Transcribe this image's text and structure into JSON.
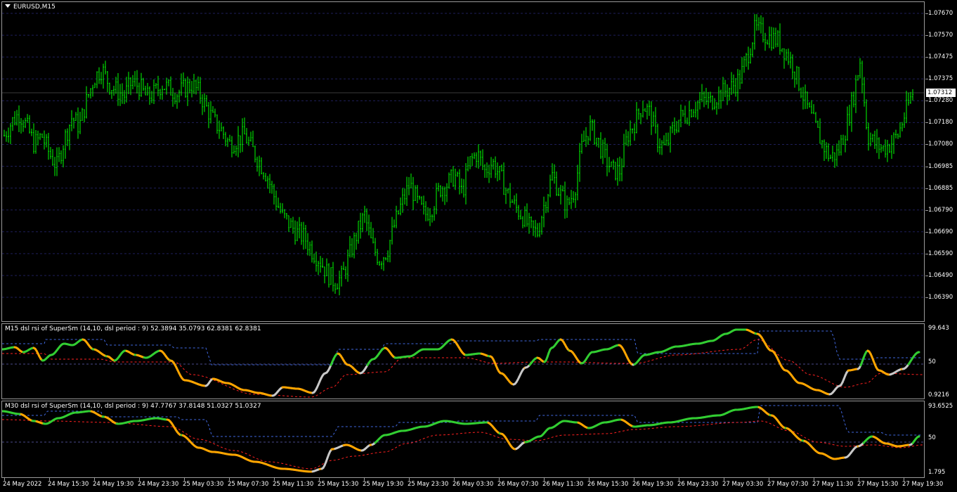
{
  "main": {
    "title": "EURUSD,M15",
    "price_labels": [
      "1.07670",
      "1.07570",
      "1.07475",
      "1.07375",
      "1.07280",
      "1.07180",
      "1.07080",
      "1.06985",
      "1.06885",
      "1.06790",
      "1.06690",
      "1.06590",
      "1.06490",
      "1.06390"
    ],
    "current_price": "1.07312",
    "colors": {
      "candles": "#00ff00",
      "grid": "#1e1e5a",
      "background": "#000000"
    },
    "price_path": [
      1.0712,
      1.0718,
      1.0722,
      1.0716,
      1.0708,
      1.0712,
      1.0704,
      1.0698,
      1.071,
      1.072,
      1.0716,
      1.0728,
      1.0738,
      1.0742,
      1.0735,
      1.0732,
      1.073,
      1.0736,
      1.0734,
      1.0729,
      1.0731,
      1.0735,
      1.0733,
      1.0731,
      1.0733,
      1.0735,
      1.0731,
      1.0724,
      1.0718,
      1.0714,
      1.0708,
      1.071,
      1.0712,
      1.0706,
      1.07,
      1.0694,
      1.0684,
      1.0676,
      1.0672,
      1.0668,
      1.0666,
      1.066,
      1.0656,
      1.065,
      1.0646,
      1.0648,
      1.0658,
      1.0668,
      1.0676,
      1.0662,
      1.0656,
      1.066,
      1.0672,
      1.0682,
      1.069,
      1.0682,
      1.0676,
      1.068,
      1.0688,
      1.069,
      1.0694,
      1.0686,
      1.07,
      1.0704,
      1.0696,
      1.07,
      1.0694,
      1.0686,
      1.068,
      1.0676,
      1.067,
      1.0668,
      1.0682,
      1.0694,
      1.0686,
      1.068,
      1.0688,
      1.0708,
      1.0716,
      1.071,
      1.0702,
      1.0696,
      1.0696,
      1.0712,
      1.0718,
      1.0726,
      1.0722,
      1.071,
      1.0706,
      1.0714,
      1.072,
      1.0722,
      1.0726,
      1.0728,
      1.0727,
      1.073,
      1.0732,
      1.0734,
      1.0738,
      1.0748,
      1.076,
      1.0758,
      1.0756,
      1.0755,
      1.075,
      1.0744,
      1.0734,
      1.0724,
      1.0716,
      1.0708,
      1.0702,
      1.0704,
      1.0714,
      1.0728,
      1.0746,
      1.0712,
      1.0708,
      1.0706,
      1.0708,
      1.0712,
      1.0722,
      1.0731
    ]
  },
  "ind1": {
    "title": "M15 dsl rsi of SuperSm (14,10, dsl period : 9) 52.3894 35.0793 62.8381 62.8381",
    "scale_labels": [
      "99.643",
      "50",
      "0.9216"
    ],
    "colors": {
      "up": "#32cd32",
      "down": "#ffa500",
      "neutral": "#c8c8c8",
      "upper_level": "#4169e1",
      "lower_level": "#ff2020"
    }
  },
  "ind2": {
    "title": "M30 dsl rsi of SuperSm (14,10, dsl period : 9) 47.7767 37.8148 51.0327 51.0327",
    "scale_labels": [
      "93.6525",
      "50",
      "1.795"
    ],
    "colors": {
      "up": "#32cd32",
      "down": "#ffa500",
      "neutral": "#c8c8c8",
      "upper_level": "#4169e1",
      "lower_level": "#ff2020"
    }
  },
  "time_labels": [
    "24 May 2022",
    "24 May 15:30",
    "24 May 19:30",
    "24 May 23:30",
    "25 May 03:30",
    "25 May 07:30",
    "25 May 11:30",
    "25 May 15:30",
    "25 May 19:30",
    "25 May 23:30",
    "26 May 03:30",
    "26 May 07:30",
    "26 May 11:30",
    "26 May 15:30",
    "26 May 19:30",
    "26 May 23:30",
    "27 May 03:30",
    "27 May 07:30",
    "27 May 11:30",
    "27 May 15:30",
    "27 May 19:30"
  ]
}
